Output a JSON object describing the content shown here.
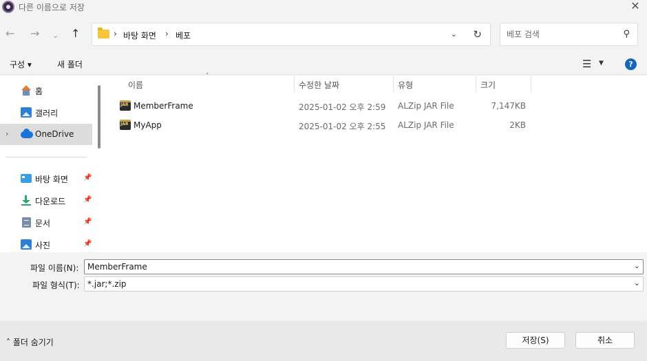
{
  "window": {
    "title": "다른 이름으로 저장",
    "close_symbol": "✕"
  },
  "nav": {
    "back_symbol": "←",
    "forward_symbol": "→",
    "recent_symbol": "⌄",
    "up_symbol": "↑",
    "breadcrumb": [
      "바탕 화면",
      "베포"
    ],
    "breadcrumb_sep": "›",
    "address_dropdown_symbol": "⌄",
    "refresh_symbol": "↻",
    "search_placeholder": "베포 검색"
  },
  "toolbar": {
    "organize_label": "구성 ▾",
    "new_folder_label": "새 폴더",
    "view_symbol": "☰",
    "view_dropdown_symbol": "▼",
    "help_symbol": "?"
  },
  "sidebar": {
    "quick": [
      {
        "label": "홈",
        "icon": "home-icon"
      },
      {
        "label": "갤러리",
        "icon": "gallery-icon"
      },
      {
        "label": "OneDrive",
        "icon": "onedrive-icon",
        "selected": true,
        "chevron": "›"
      }
    ],
    "pinned": [
      {
        "label": "바탕 화면",
        "icon": "desktop-icon"
      },
      {
        "label": "다운로드",
        "icon": "download-icon"
      },
      {
        "label": "문서",
        "icon": "documents-icon"
      },
      {
        "label": "사진",
        "icon": "pictures-icon"
      }
    ],
    "pin_symbol": "📌"
  },
  "files": {
    "sort_arrow": "˄",
    "columns": [
      "이름",
      "수정한 날짜",
      "유형",
      "크기"
    ],
    "rows": [
      {
        "name": "MemberFrame",
        "date": "2025-01-02 오후 2:59",
        "type": "ALZip JAR File",
        "size": "7,147KB"
      },
      {
        "name": "MyApp",
        "date": "2025-01-02 오후 2:55",
        "type": "ALZip JAR File",
        "size": "2KB"
      }
    ]
  },
  "form": {
    "filename_label": "파일 이름(N):",
    "filename_value": "MemberFrame",
    "filetype_label": "파일 형식(T):",
    "filetype_value": "*.jar;*.zip",
    "dropdown_symbol": "⌄"
  },
  "footer": {
    "hide_folders_label": "˄  폴더 숨기기",
    "save_label": "저장(S)",
    "cancel_label": "취소"
  },
  "colors": {
    "accent": "#1565c0",
    "selected_bg": "#dcdcdc",
    "folder": "#f8c53a"
  }
}
